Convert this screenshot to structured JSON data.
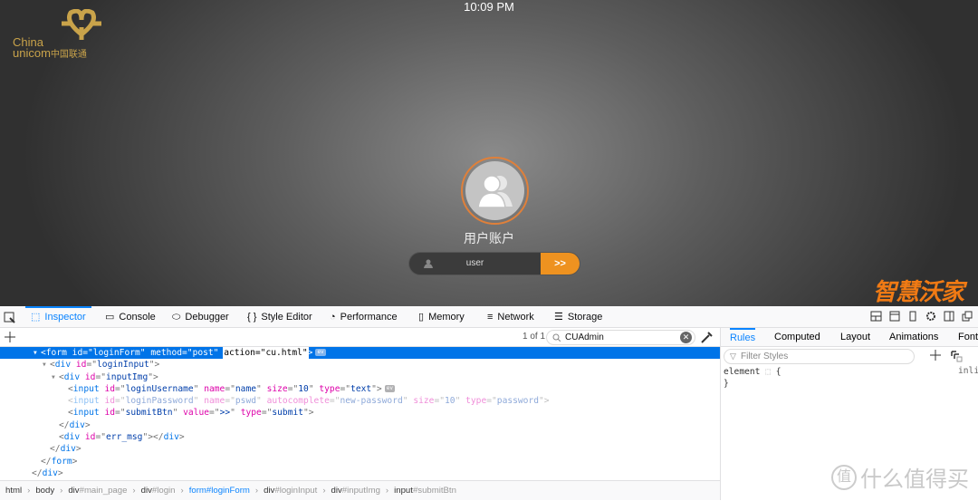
{
  "page": {
    "clock": "10:09 PM",
    "logo": {
      "line1": "China",
      "line2": "unicom",
      "cn": "中国联通",
      "color": "#c9a34a"
    },
    "account_label": "用户账户",
    "username_value": "user",
    "submit_label": ">>",
    "accent": "#ee9220",
    "brand_logo": "智慧沃家"
  },
  "devtools": {
    "tabs": [
      {
        "label": "Inspector",
        "icon": "inspector-icon",
        "selected": true
      },
      {
        "label": "Console",
        "icon": "console-icon"
      },
      {
        "label": "Debugger",
        "icon": "debugger-icon"
      },
      {
        "label": "Style Editor",
        "icon": "braces-icon"
      },
      {
        "label": "Performance",
        "icon": "performance-icon"
      },
      {
        "label": "Memory",
        "icon": "memory-icon"
      },
      {
        "label": "Network",
        "icon": "network-icon"
      },
      {
        "label": "Storage",
        "icon": "storage-icon"
      }
    ],
    "search": {
      "count": "1 of 1",
      "value": "CUAdmin"
    },
    "tree": [
      {
        "depth": 0,
        "sel": true,
        "toggle": "open",
        "tokens": [
          [
            "p",
            "<"
          ],
          [
            "tag",
            "form"
          ],
          [
            "p",
            " "
          ],
          [
            "attr",
            "id"
          ],
          [
            "p",
            "=\""
          ],
          [
            "val",
            "loginForm"
          ],
          [
            "p",
            "\" "
          ],
          [
            "attr",
            "method"
          ],
          [
            "p",
            "=\""
          ],
          [
            "val",
            "post"
          ],
          [
            "p",
            "\" "
          ],
          [
            "hl",
            "action=\"cu.html\""
          ],
          [
            "p",
            ">"
          ],
          [
            "ev",
            "ev"
          ]
        ]
      },
      {
        "depth": 1,
        "toggle": "open",
        "tokens": [
          [
            "p",
            "<"
          ],
          [
            "tag",
            "div"
          ],
          [
            "p",
            " "
          ],
          [
            "attr",
            "id"
          ],
          [
            "p",
            "=\""
          ],
          [
            "val",
            "loginInput"
          ],
          [
            "p",
            "\">"
          ]
        ]
      },
      {
        "depth": 2,
        "toggle": "open",
        "tokens": [
          [
            "p",
            "<"
          ],
          [
            "tag",
            "div"
          ],
          [
            "p",
            " "
          ],
          [
            "attr",
            "id"
          ],
          [
            "p",
            "=\""
          ],
          [
            "val",
            "inputImg"
          ],
          [
            "p",
            "\">"
          ]
        ]
      },
      {
        "depth": 3,
        "tokens": [
          [
            "p",
            "<"
          ],
          [
            "tag",
            "input"
          ],
          [
            "p",
            " "
          ],
          [
            "attr",
            "id"
          ],
          [
            "p",
            "=\""
          ],
          [
            "val",
            "loginUsername"
          ],
          [
            "p",
            "\" "
          ],
          [
            "attr",
            "name"
          ],
          [
            "p",
            "=\""
          ],
          [
            "val",
            "name"
          ],
          [
            "p",
            "\" "
          ],
          [
            "attr",
            "size"
          ],
          [
            "p",
            "=\""
          ],
          [
            "val",
            "10"
          ],
          [
            "p",
            "\" "
          ],
          [
            "attr",
            "type"
          ],
          [
            "p",
            "=\""
          ],
          [
            "val",
            "text"
          ],
          [
            "p",
            "\">"
          ],
          [
            "ev",
            "ev"
          ]
        ]
      },
      {
        "depth": 3,
        "dim": true,
        "tokens": [
          [
            "p",
            "<"
          ],
          [
            "tag",
            "input"
          ],
          [
            "p",
            " "
          ],
          [
            "attr",
            "id"
          ],
          [
            "p",
            "=\""
          ],
          [
            "val",
            "loginPassword"
          ],
          [
            "p",
            "\" "
          ],
          [
            "attr",
            "name"
          ],
          [
            "p",
            "=\""
          ],
          [
            "val",
            "pswd"
          ],
          [
            "p",
            "\" "
          ],
          [
            "attr",
            "autocomplete"
          ],
          [
            "p",
            "=\""
          ],
          [
            "val",
            "new-password"
          ],
          [
            "p",
            "\" "
          ],
          [
            "attr",
            "size"
          ],
          [
            "p",
            "=\""
          ],
          [
            "val",
            "10"
          ],
          [
            "p",
            "\" "
          ],
          [
            "attr",
            "type"
          ],
          [
            "p",
            "=\""
          ],
          [
            "val",
            "password"
          ],
          [
            "p",
            "\">"
          ]
        ]
      },
      {
        "depth": 3,
        "tokens": [
          [
            "p",
            "<"
          ],
          [
            "tag",
            "input"
          ],
          [
            "p",
            " "
          ],
          [
            "attr",
            "id"
          ],
          [
            "p",
            "=\""
          ],
          [
            "val",
            "submitBtn"
          ],
          [
            "p",
            "\" "
          ],
          [
            "attr",
            "value"
          ],
          [
            "p",
            "=\""
          ],
          [
            "val",
            ">>"
          ],
          [
            "p",
            "\" "
          ],
          [
            "attr",
            "type"
          ],
          [
            "p",
            "=\""
          ],
          [
            "val",
            "submit"
          ],
          [
            "p",
            "\">"
          ]
        ]
      },
      {
        "depth": 2,
        "tokens": [
          [
            "p",
            "</"
          ],
          [
            "tag",
            "div"
          ],
          [
            "p",
            ">"
          ]
        ]
      },
      {
        "depth": 2,
        "tokens": [
          [
            "p",
            "<"
          ],
          [
            "tag",
            "div"
          ],
          [
            "p",
            " "
          ],
          [
            "attr",
            "id"
          ],
          [
            "p",
            "=\""
          ],
          [
            "val",
            "err_msg"
          ],
          [
            "p",
            "\"></"
          ],
          [
            "tag",
            "div"
          ],
          [
            "p",
            ">"
          ]
        ]
      },
      {
        "depth": 1,
        "tokens": [
          [
            "p",
            "</"
          ],
          [
            "tag",
            "div"
          ],
          [
            "p",
            ">"
          ]
        ]
      },
      {
        "depth": 0,
        "tokens": [
          [
            "p",
            "</"
          ],
          [
            "tag",
            "form"
          ],
          [
            "p",
            ">"
          ]
        ]
      },
      {
        "depth": -1,
        "tokens": [
          [
            "p",
            "</"
          ],
          [
            "tag",
            "div"
          ],
          [
            "p",
            ">"
          ]
        ]
      }
    ],
    "breadcrumb": [
      [
        "html",
        ""
      ],
      [
        "body",
        ""
      ],
      [
        "div",
        "#main_page"
      ],
      [
        "div",
        "#login"
      ],
      [
        "form",
        "#loginForm"
      ],
      [
        "div",
        "#loginInput"
      ],
      [
        "div",
        "#inputImg"
      ],
      [
        "input",
        "#submitBtn"
      ]
    ],
    "breadcrumb_selected": 4,
    "side_tabs": [
      "Rules",
      "Computed",
      "Layout",
      "Animations",
      "Fonts"
    ],
    "filter_placeholder": "Filter Styles",
    "rules": {
      "selector": "element",
      "open": "{",
      "close": "}",
      "source": "inline"
    },
    "watermark": "什么值得买",
    "watermark_badge": "值",
    "accent": "#0a84ff"
  }
}
